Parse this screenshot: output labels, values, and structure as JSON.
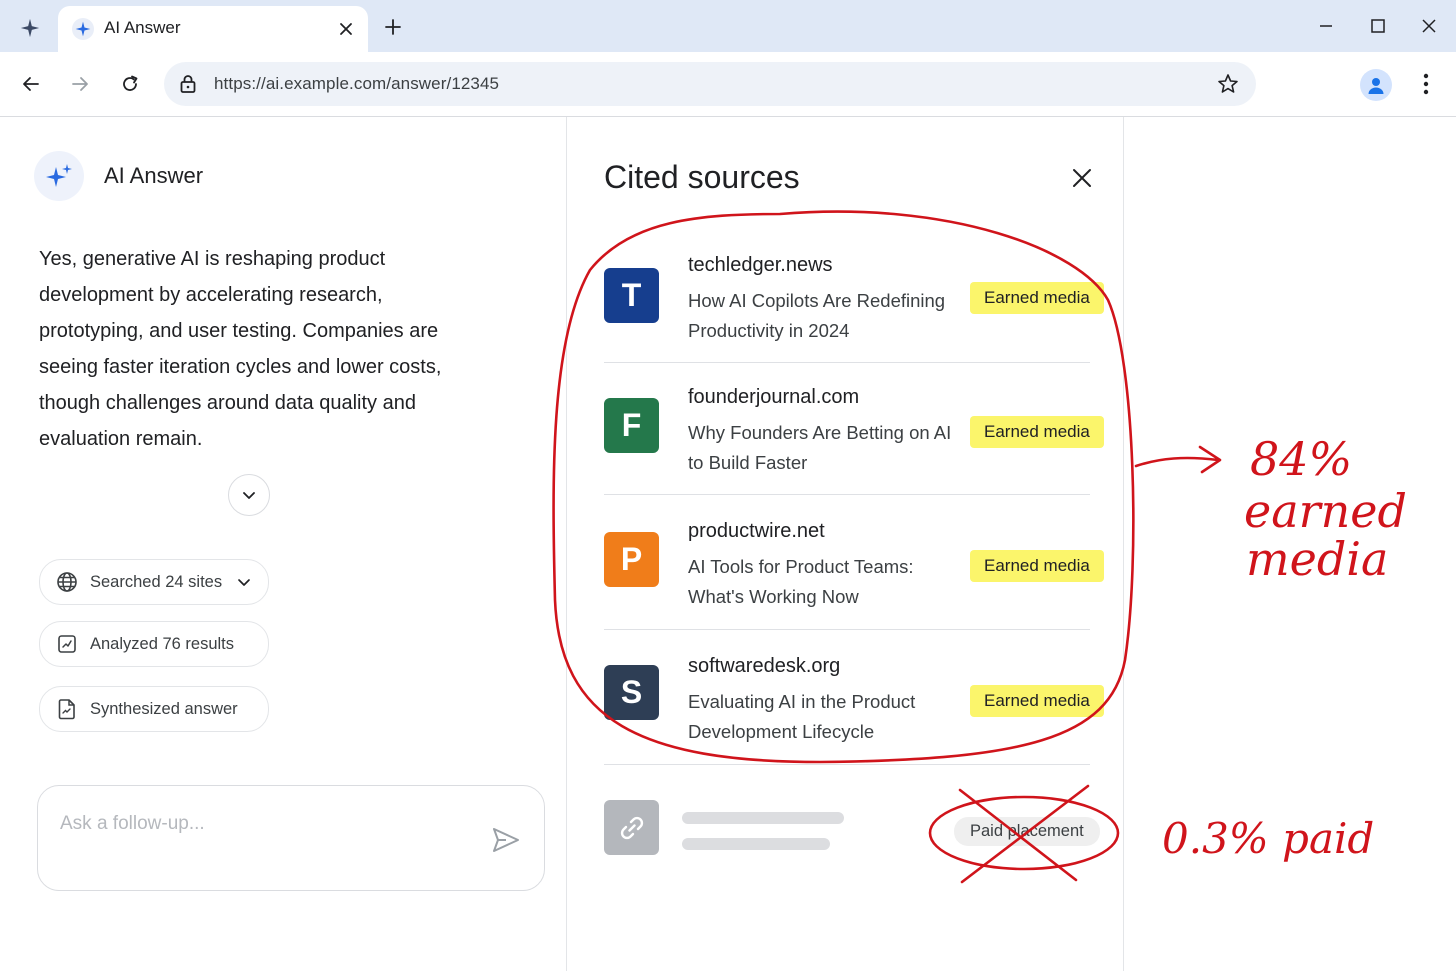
{
  "browser": {
    "tab_title": "AI Answer",
    "url": "https://ai.example.com/answer/12345"
  },
  "answer": {
    "title": "AI Answer",
    "text": "Yes, generative AI is reshaping product development by accelerating research, prototyping, and user testing. Companies are seeing faster iteration cycles and lower costs, though challenges around data quality and evaluation remain.",
    "steps": [
      {
        "label": "Searched 24 sites",
        "icon": "globe-icon"
      },
      {
        "label": "Analyzed 76 results",
        "icon": "chart-icon"
      },
      {
        "label": "Synthesized answer",
        "icon": "document-icon"
      }
    ],
    "followup_placeholder": "Ask a follow-up..."
  },
  "sources": {
    "title": "Cited sources",
    "items": [
      {
        "letter": "T",
        "domain": "techledger.news",
        "headline": "How AI Copilots Are Redefining Productivity in 2024",
        "badge": "Earned media",
        "color": "#163e8e"
      },
      {
        "letter": "F",
        "domain": "founderjournal.com",
        "headline": "Why Founders Are Betting on AI to Build Faster",
        "badge": "Earned media",
        "color": "#24784b"
      },
      {
        "letter": "P",
        "domain": "productwire.net",
        "headline": "AI Tools for Product Teams: What's Working Now",
        "badge": "Earned media",
        "color": "#f07d1a"
      },
      {
        "letter": "S",
        "domain": "softwaredesk.org",
        "headline": "Evaluating AI in the Product Development Lifecycle",
        "badge": "Earned media",
        "color": "#2e3e55"
      }
    ],
    "paid": {
      "badge": "Paid placement",
      "icon": "link-icon"
    }
  },
  "annotations": {
    "earned_line1": "84%",
    "earned_line2": "earned",
    "earned_line3": "media",
    "paid_note": "0.3% paid",
    "ink_color": "#d0141b"
  }
}
